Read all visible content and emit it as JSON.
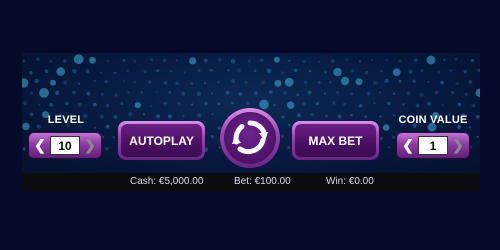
{
  "controls": {
    "level": {
      "label": "LEVEL",
      "value": "10",
      "left_arrow": "❮",
      "right_arrow": "❯"
    },
    "autoplay_label": "AUTOPLAY",
    "max_bet_label": "MAX BET",
    "coin_value": {
      "label": "COIN VALUE",
      "value": "1",
      "left_arrow": "❮",
      "right_arrow": "❯"
    }
  },
  "status": {
    "cash": "Cash: €5,000.00",
    "bet": "Bet: €100.00",
    "win": "Win: €0.00"
  },
  "icons": {
    "spin": "spin-arrows-icon"
  },
  "colors": {
    "background": "#050a2a",
    "button_purple": "#9a45b3",
    "button_inner": "#4a0f63",
    "status_bar": "#0c0c10"
  }
}
